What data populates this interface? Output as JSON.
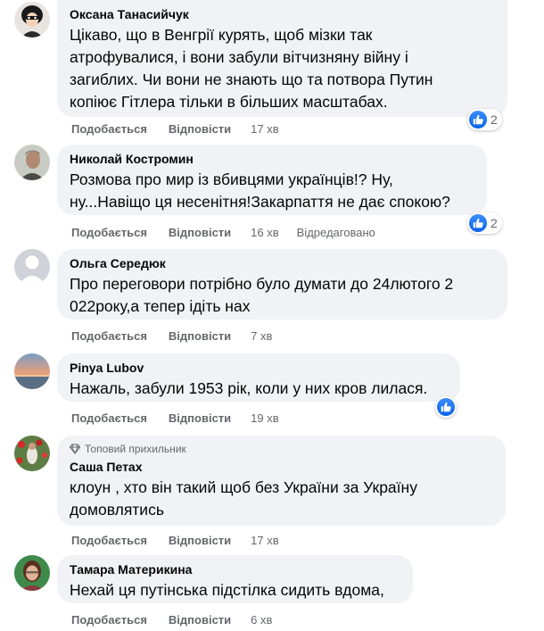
{
  "colors": {
    "bubble_bg": "#f0f2f5",
    "meta_text": "#65676b",
    "like_blue": "#1877f2"
  },
  "actions": {
    "like_label": "Подобається",
    "reply_label": "Відповісти",
    "edited_label": "Відредаговано"
  },
  "comments": [
    {
      "author": "Оксана Танасийчук",
      "lines": [
        "Цікаво, що в Венгрії курять, щоб мізки так",
        "атрофувалися, і вони забули вітчизняну війну і",
        "загиблих. Чи вони не знають що та потвора Путин",
        "копіює Гітлера тільки в більших масштабах."
      ],
      "time": "17 хв",
      "reactions": "2",
      "avatar_icon": "incredibles-avatar"
    },
    {
      "author": "Николай Костромин",
      "lines": [
        "Розмова про мир із вбивцями українців!? Ну,",
        "ну...Навіщо ця несенітня!Закарпаття не дає спокою?"
      ],
      "time": "16 хв",
      "edited": true,
      "reactions": "2",
      "avatar_icon": "man-portrait-avatar"
    },
    {
      "author": "Ольга Середюк",
      "lines": [
        "Про переговори потрібно було думати до 24лютого 2",
        "022року,а тепер ідіть нах"
      ],
      "time": "7 хв",
      "avatar_icon": "default-profile-avatar"
    },
    {
      "author": "Pinya Lubov",
      "lines": [
        "Нажаль, забули 1953 рік, коли у них кров лилася."
      ],
      "time": "19 хв",
      "reactions": "",
      "avatar_icon": "sunset-sea-avatar"
    },
    {
      "badge": "Топовий прихильник",
      "badge_icon": "diamond-icon",
      "author": "Саша Петах",
      "lines": [
        "клоун , хто він такий щоб без України за Україну",
        "домовлятись"
      ],
      "time": "17 хв",
      "avatar_icon": "flowers-field-avatar"
    },
    {
      "author": "Тамара Материкина",
      "lines": [
        "Нехай ця путінська підстілка сидить вдома,"
      ],
      "time": "6 хв",
      "avatar_icon": "woman-portrait-avatar"
    }
  ]
}
